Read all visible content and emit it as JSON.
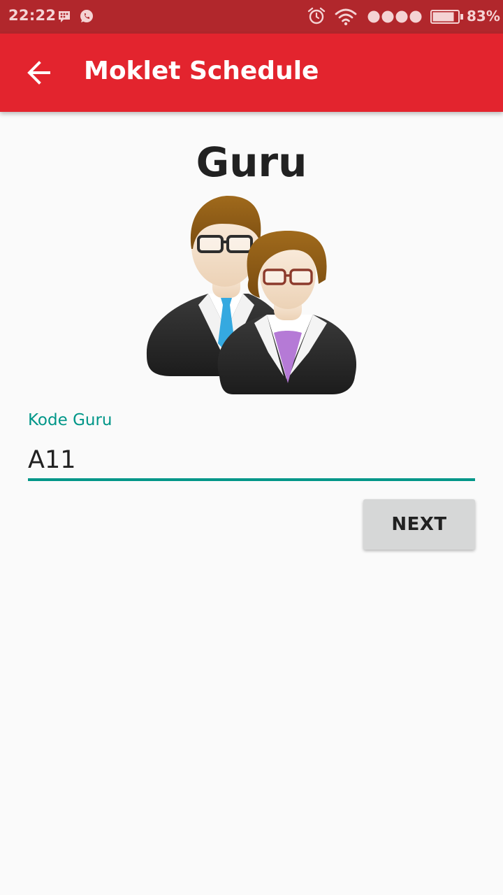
{
  "status_bar": {
    "time": "22:22",
    "battery_percent": "83%",
    "battery_level": 0.83,
    "signal_bars": 4,
    "icons": [
      "bbm-icon",
      "whatsapp-icon",
      "alarm-icon",
      "wifi-icon",
      "signal-icon",
      "battery-icon"
    ]
  },
  "app_bar": {
    "title": "Moklet Schedule",
    "back_icon": "arrow-back-icon"
  },
  "main": {
    "heading": "Guru",
    "illustration_icon": "teachers-icon",
    "field": {
      "label": "Kode Guru",
      "value": "A11"
    },
    "next_button": "NEXT"
  },
  "colors": {
    "status_bar": "#b1272c",
    "app_bar": "#e3242e",
    "accent": "#009688",
    "background": "#fafafa",
    "button": "#d6d7d7"
  }
}
